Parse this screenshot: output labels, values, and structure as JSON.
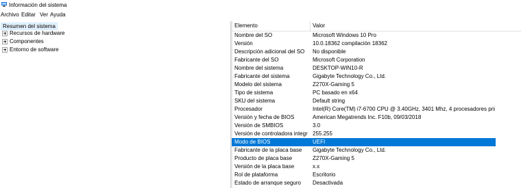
{
  "window": {
    "title": "Información del sistema",
    "icon": "system-info-icon"
  },
  "menu": [
    "Archivo",
    "Editar",
    "Ver",
    "Ayuda"
  ],
  "tree": {
    "root": "Resumen del sistema",
    "children": [
      "Recursos de hardware",
      "Componentes",
      "Entorno de software"
    ]
  },
  "table": {
    "headers": [
      "Elemento",
      "Valor"
    ],
    "rows": [
      [
        "Nombre del SO",
        "Microsoft Windows 10 Pro"
      ],
      [
        "Versión",
        "10.0.18362 compilación 18362"
      ],
      [
        "Descripción adicional del SO",
        "No disponible"
      ],
      [
        "Fabricante del SO",
        "Microsoft Corporation"
      ],
      [
        "Nombre del sistema",
        "DESKTOP-WIN10-R"
      ],
      [
        "Fabricante del sistema",
        "Gigabyte Technology Co., Ltd."
      ],
      [
        "Modelo del sistema",
        "Z270X-Gaming 5"
      ],
      [
        "Tipo de sistema",
        "PC basado en x64"
      ],
      [
        "SKU del sistema",
        "Default string"
      ],
      [
        "Procesador",
        "Intel(R) Core(TM) i7-6700 CPU @ 3.40GHz, 3401 Mhz, 4 procesadores princip..."
      ],
      [
        "Versión y fecha de BIOS",
        "American Megatrends Inc. F10b, 09/03/2018"
      ],
      [
        "Versión de SMBIOS",
        "3.0"
      ],
      [
        "Versión de controladora integr...",
        "255.255"
      ],
      [
        "Modo de BIOS",
        "UEFI"
      ],
      [
        "Fabricante de la placa base",
        "Gigabyte Technology Co., Ltd."
      ],
      [
        "Producto de placa base",
        "Z270X-Gaming 5"
      ],
      [
        "Versión de la placa base",
        "x.x"
      ],
      [
        "Rol de plataforma",
        "Escritorio"
      ],
      [
        "Estado de arranque seguro",
        "Desactivada"
      ]
    ],
    "selected_row": "Modo de BIOS"
  },
  "colors": {
    "selection": "#0078d7",
    "tree_highlight": "#e5f3ff"
  }
}
